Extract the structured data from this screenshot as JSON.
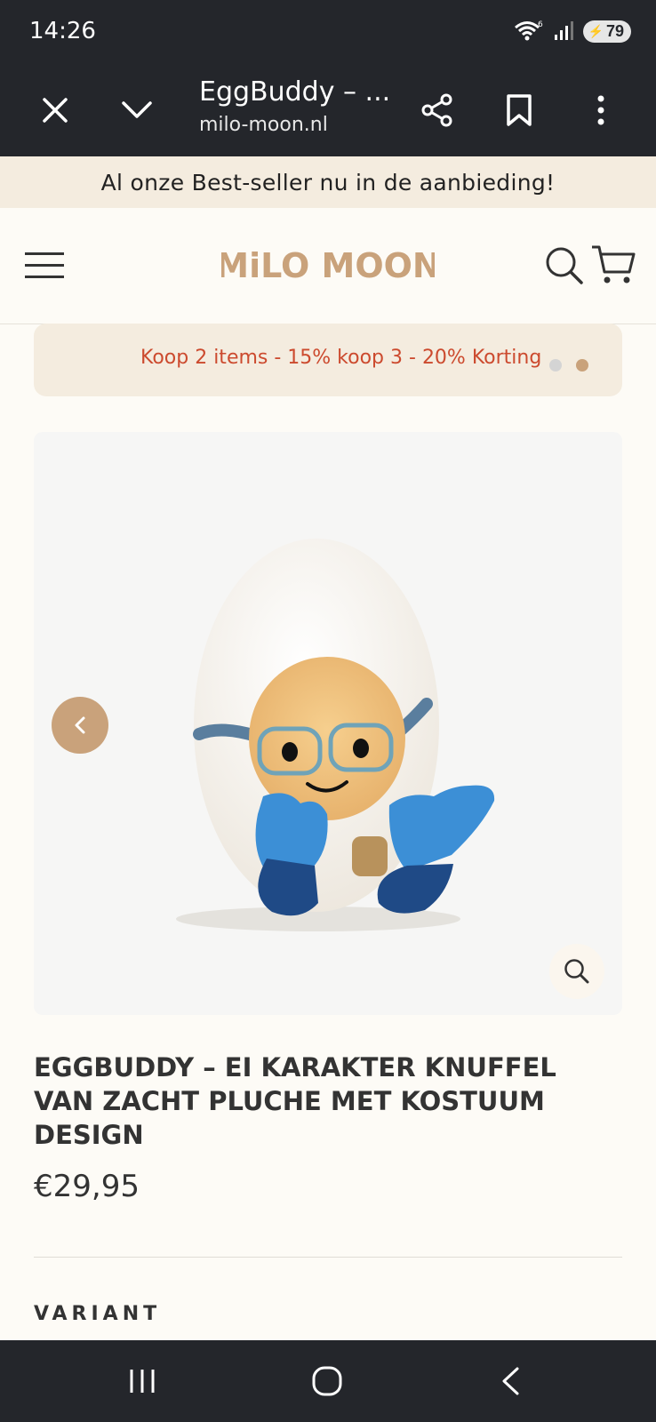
{
  "status_bar": {
    "time": "14:26",
    "battery": "79",
    "wifi_badge": "6"
  },
  "browser": {
    "title": "EggBuddy – ...",
    "url": "milo-moon.nl"
  },
  "announcement": "Al onze Best-seller nu in de aanbieding!",
  "header": {
    "logo_text": "MiLO MOON"
  },
  "promo": {
    "text": "Koop 2 items - 15% koop 3 - 20% Korting",
    "active_slide": 2,
    "slide_count": 2
  },
  "product": {
    "title": "EGGBUDDY – EI KARAKTER KNUFFEL VAN ZACHT PLUCHE MET KOSTUUM DESIGN",
    "price": "€29,95",
    "variant_label": "VARIANT"
  },
  "colors": {
    "accent": "#c9a27b",
    "promo_text": "#cc4a2e",
    "announcement_bg": "#f4ecdf",
    "browser_bar": "#24262b"
  }
}
